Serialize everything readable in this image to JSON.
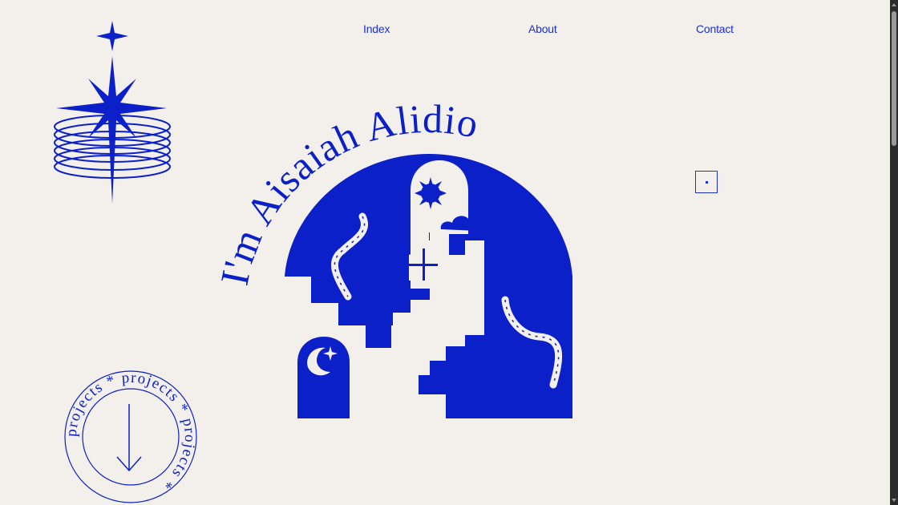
{
  "nav": {
    "index_label": "Index",
    "about_label": "About",
    "contact_label": "Contact"
  },
  "hero": {
    "title": "I'm Aisaiah Alidio"
  },
  "projects_badge": {
    "ring_text": "projects * projects * projects *"
  },
  "colors": {
    "brand_blue": "#0b20c8",
    "background": "#f3f0eb"
  },
  "icons": [
    "star-rings-icon",
    "arrow-down-icon",
    "sun-icon",
    "moon-icon",
    "cloud-icon",
    "snake-icon"
  ]
}
